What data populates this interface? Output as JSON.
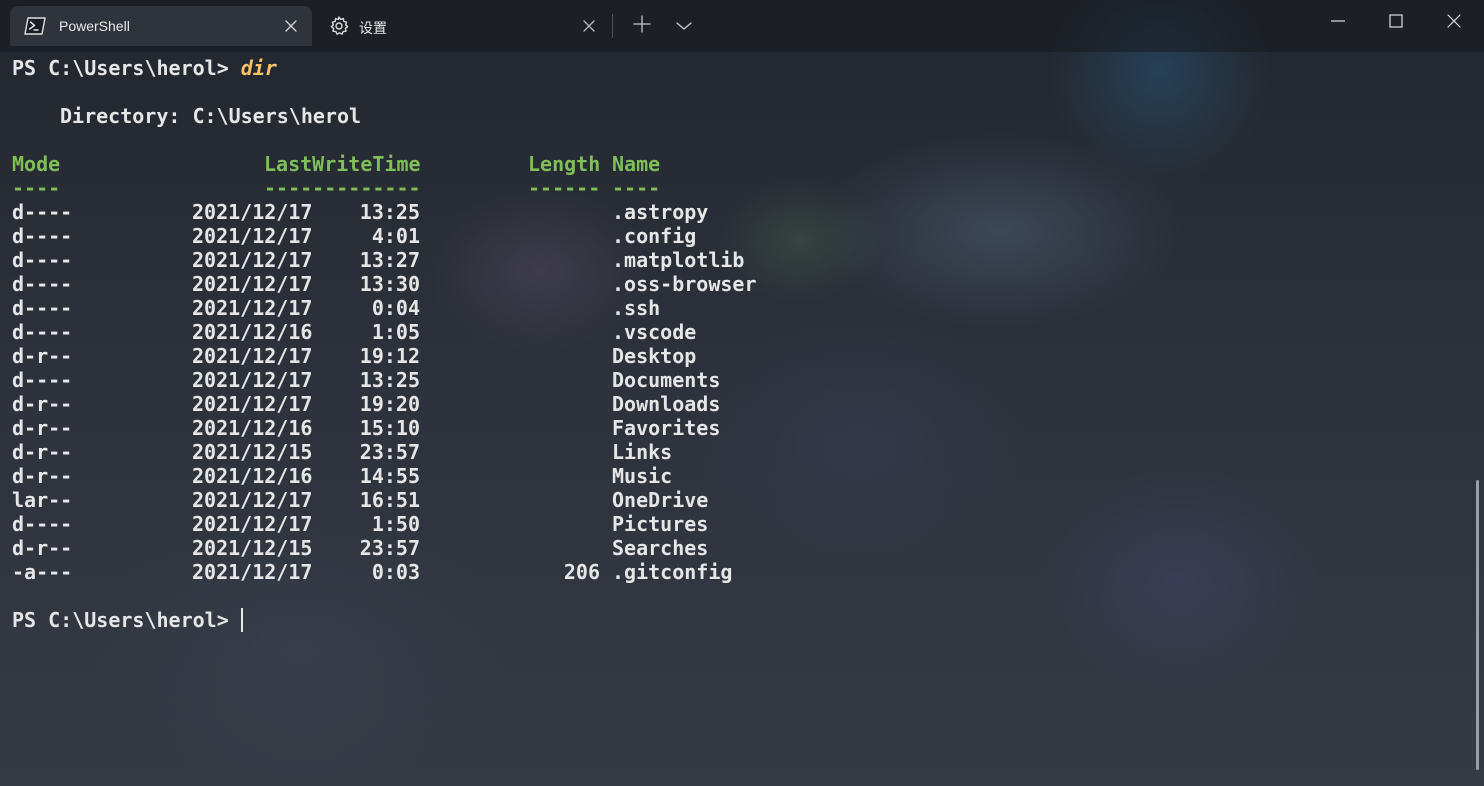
{
  "tabs": [
    {
      "label": "PowerShell",
      "icon": "powershell-icon",
      "active": true
    },
    {
      "label": "设置",
      "icon": "gear-icon",
      "active": false
    }
  ],
  "titlebar": {
    "new_tab_icon": "plus-icon",
    "dropdown_icon": "chevron-down-icon",
    "minimize_icon": "minimize-icon",
    "maximize_icon": "maximize-icon",
    "close_icon": "close-icon"
  },
  "terminal": {
    "prompt": "PS C:\\Users\\herol> ",
    "command": "dir",
    "directory_line": "Directory: C:\\Users\\herol",
    "headers": {
      "mode": "Mode",
      "last_write_time": "LastWriteTime",
      "length": "Length",
      "name": "Name"
    },
    "underlines": {
      "mode": "----",
      "last_write_time": "-------------",
      "length": "------",
      "name": "----"
    },
    "rows": [
      {
        "mode": "d----",
        "date": "2021/12/17",
        "time": "13:25",
        "length": "",
        "name": ".astropy"
      },
      {
        "mode": "d----",
        "date": "2021/12/17",
        "time": "4:01",
        "length": "",
        "name": ".config"
      },
      {
        "mode": "d----",
        "date": "2021/12/17",
        "time": "13:27",
        "length": "",
        "name": ".matplotlib"
      },
      {
        "mode": "d----",
        "date": "2021/12/17",
        "time": "13:30",
        "length": "",
        "name": ".oss-browser"
      },
      {
        "mode": "d----",
        "date": "2021/12/17",
        "time": "0:04",
        "length": "",
        "name": ".ssh"
      },
      {
        "mode": "d----",
        "date": "2021/12/16",
        "time": "1:05",
        "length": "",
        "name": ".vscode"
      },
      {
        "mode": "d-r--",
        "date": "2021/12/17",
        "time": "19:12",
        "length": "",
        "name": "Desktop"
      },
      {
        "mode": "d----",
        "date": "2021/12/17",
        "time": "13:25",
        "length": "",
        "name": "Documents"
      },
      {
        "mode": "d-r--",
        "date": "2021/12/17",
        "time": "19:20",
        "length": "",
        "name": "Downloads"
      },
      {
        "mode": "d-r--",
        "date": "2021/12/16",
        "time": "15:10",
        "length": "",
        "name": "Favorites"
      },
      {
        "mode": "d-r--",
        "date": "2021/12/15",
        "time": "23:57",
        "length": "",
        "name": "Links"
      },
      {
        "mode": "d-r--",
        "date": "2021/12/16",
        "time": "14:55",
        "length": "",
        "name": "Music"
      },
      {
        "mode": "lar--",
        "date": "2021/12/17",
        "time": "16:51",
        "length": "",
        "name": "OneDrive"
      },
      {
        "mode": "d----",
        "date": "2021/12/17",
        "time": "1:50",
        "length": "",
        "name": "Pictures"
      },
      {
        "mode": "d-r--",
        "date": "2021/12/15",
        "time": "23:57",
        "length": "",
        "name": "Searches"
      },
      {
        "mode": "-a---",
        "date": "2021/12/17",
        "time": "0:03",
        "length": "206",
        "name": ".gitconfig"
      }
    ],
    "final_prompt": "PS C:\\Users\\herol> ",
    "final_input": ""
  },
  "colors": {
    "header_green": "#7fbf58",
    "command_yellow": "#f5c266",
    "text": "#e6e6e6",
    "active_tab": "#2f333b"
  }
}
